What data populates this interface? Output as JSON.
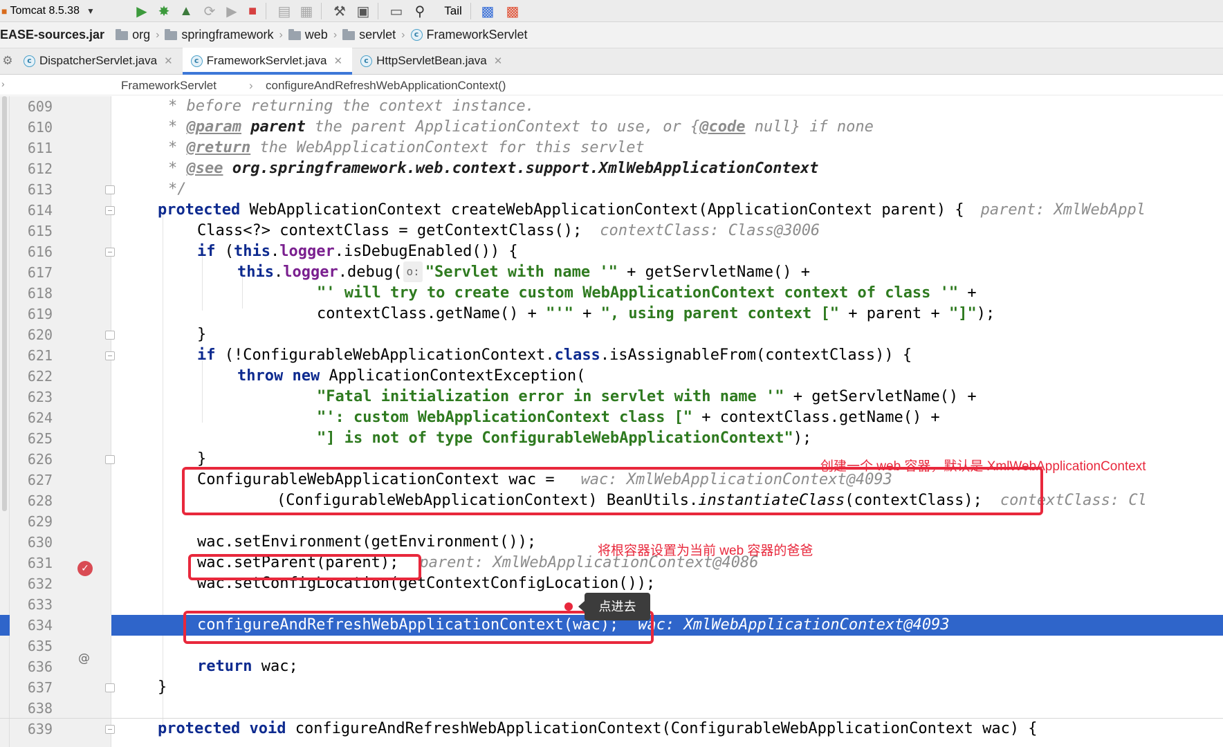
{
  "toolbar": {
    "run_config": "Tomcat 8.5.38",
    "tail_label": "Tail"
  },
  "navbar": {
    "jar": "EASE-sources.jar",
    "crumbs": [
      "org",
      "springframework",
      "web",
      "servlet"
    ],
    "class_name": "FrameworkServlet"
  },
  "tabs": [
    {
      "label": "DispatcherServlet.java"
    },
    {
      "label": "FrameworkServlet.java"
    },
    {
      "label": "HttpServletBean.java"
    }
  ],
  "editor_breadcrumb": {
    "class_name": "FrameworkServlet",
    "method_name": "configureAndRefreshWebApplicationContext()"
  },
  "line_numbers": [
    "609",
    "610",
    "611",
    "612",
    "613",
    "614",
    "615",
    "616",
    "617",
    "618",
    "619",
    "620",
    "621",
    "622",
    "623",
    "624",
    "625",
    "626",
    "627",
    "628",
    "629",
    "630",
    "631",
    "632",
    "633",
    "634",
    "635",
    "636",
    "637",
    "638",
    "639"
  ],
  "code": {
    "l609": "* before returning the context instance.",
    "l610": {
      "star": "* ",
      "tag": "@param",
      "p": " parent",
      "t1": " the parent ApplicationContext to use, or {",
      "tag2": "@code",
      "t2": " null} if none"
    },
    "l611": {
      "star": "* ",
      "tag": "@return",
      "t": " the WebApplicationContext for this servlet"
    },
    "l612": {
      "star": "* ",
      "tag": "@see",
      "t": " org.springframework.web.context.support.XmlWebApplicationContext"
    },
    "l613": "*/",
    "l614": {
      "kw": "protected",
      "t": " WebApplicationContext createWebApplicationContext(ApplicationContext parent) {",
      "hint": "parent: XmlWebAppl"
    },
    "l615": {
      "t": "Class<?> contextClass = getContextClass();",
      "hint": "contextClass: Class@3006"
    },
    "l616": {
      "kw": "if",
      "t1": " (",
      "kw2": "this",
      "t2": ".",
      "fld": "logger",
      "t3": ".isDebugEnabled()) {"
    },
    "l617": {
      "kw": "this",
      "t1": ".",
      "fld": "logger",
      "t2": ".debug(",
      "ph": "o:",
      "str": "\"Servlet with name '\"",
      "t3": " + getServletName() +"
    },
    "l618": {
      "str": "\"' will try to create custom WebApplicationContext context of class '\"",
      "t": " +"
    },
    "l619": {
      "t1": "contextClass.getName() + ",
      "str1": "\"'\"",
      "t2": " + ",
      "str2": "\", using parent context [\"",
      "t3": " + parent + ",
      "str3": "\"]\"",
      "t4": ");"
    },
    "l620": "}",
    "l621": {
      "kw": "if",
      "t1": " (!ConfigurableWebApplicationContext.",
      "kw2": "class",
      "t2": ".isAssignableFrom(contextClass)) {"
    },
    "l622": {
      "kw": "throw",
      "kw2": "new",
      "t": " ApplicationContextException("
    },
    "l623": {
      "str": "\"Fatal initialization error in servlet with name '\"",
      "t": " + getServletName() +"
    },
    "l624": {
      "str": "\"': custom WebApplicationContext class [\"",
      "t": " + contextClass.getName() +"
    },
    "l625": {
      "str": "\"] is not of type ConfigurableWebApplicationContext\"",
      "t": ");"
    },
    "l626": "}",
    "l627": {
      "t": "ConfigurableWebApplicationContext wac =",
      "hint": "wac: XmlWebApplicationContext@4093"
    },
    "l628": {
      "t1": "(ConfigurableWebApplicationContext) BeanUtils.",
      "stat": "instantiateClass",
      "t2": "(contextClass);",
      "hint": "contextClass: Cl"
    },
    "l630": "wac.setEnvironment(getEnvironment());",
    "l631": {
      "t": "wac.setParent(parent);",
      "hint": "parent: XmlWebApplicationContext@4086"
    },
    "l632": "wac.setConfigLocation(getContextConfigLocation());",
    "l634": {
      "t": "configureAndRefreshWebApplicationContext(wac);",
      "hint": "wac: XmlWebApplicationContext@4093"
    },
    "l636": {
      "kw": "return",
      "t": " wac;"
    },
    "l637": "}",
    "l639": {
      "kw": "protected",
      "kw2": "void",
      "t": " configureAndRefreshWebApplicationContext(ConfigurableWebApplicationContext wac) {"
    }
  },
  "annotations": {
    "note1": "创建一个 web 容器，默认是 XmlWebApplicationContext",
    "note2": "将根容器设置为当前 web 容器的爸爸",
    "tooltip": "点进去"
  },
  "colors": {
    "highlight": "#2f65ca",
    "annotation_red": "#e8283c",
    "keyword": "#0d2a8f",
    "string": "#2e7a1f",
    "field": "#7a1f8f"
  }
}
